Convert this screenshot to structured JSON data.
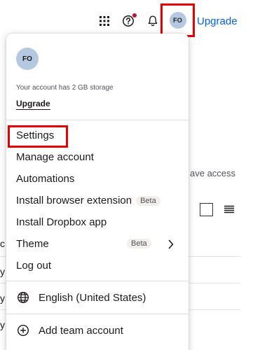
{
  "topbar": {
    "grid_icon": "apps-grid-icon",
    "help_icon": "help-icon",
    "bell_icon": "notifications-icon",
    "avatar_initials": "FO",
    "upgrade_label": "Upgrade",
    "accent_color": "#0061fe"
  },
  "background": {
    "access_text": "ave access",
    "row_letters": [
      "c",
      "y",
      "y",
      "y"
    ]
  },
  "menu": {
    "avatar_initials": "FO",
    "storage_text": "Your account has 2 GB storage",
    "upgrade_label": "Upgrade",
    "items": [
      {
        "label": "Settings"
      },
      {
        "label": "Manage account"
      },
      {
        "label": "Automations"
      },
      {
        "label": "Install browser extension",
        "badge": "Beta"
      },
      {
        "label": "Install Dropbox app"
      },
      {
        "label": "Theme",
        "badge": "Beta"
      },
      {
        "label": "Log out"
      }
    ],
    "language": "English (United States)",
    "add_team": "Add team account"
  },
  "highlight_color": "#e60000"
}
